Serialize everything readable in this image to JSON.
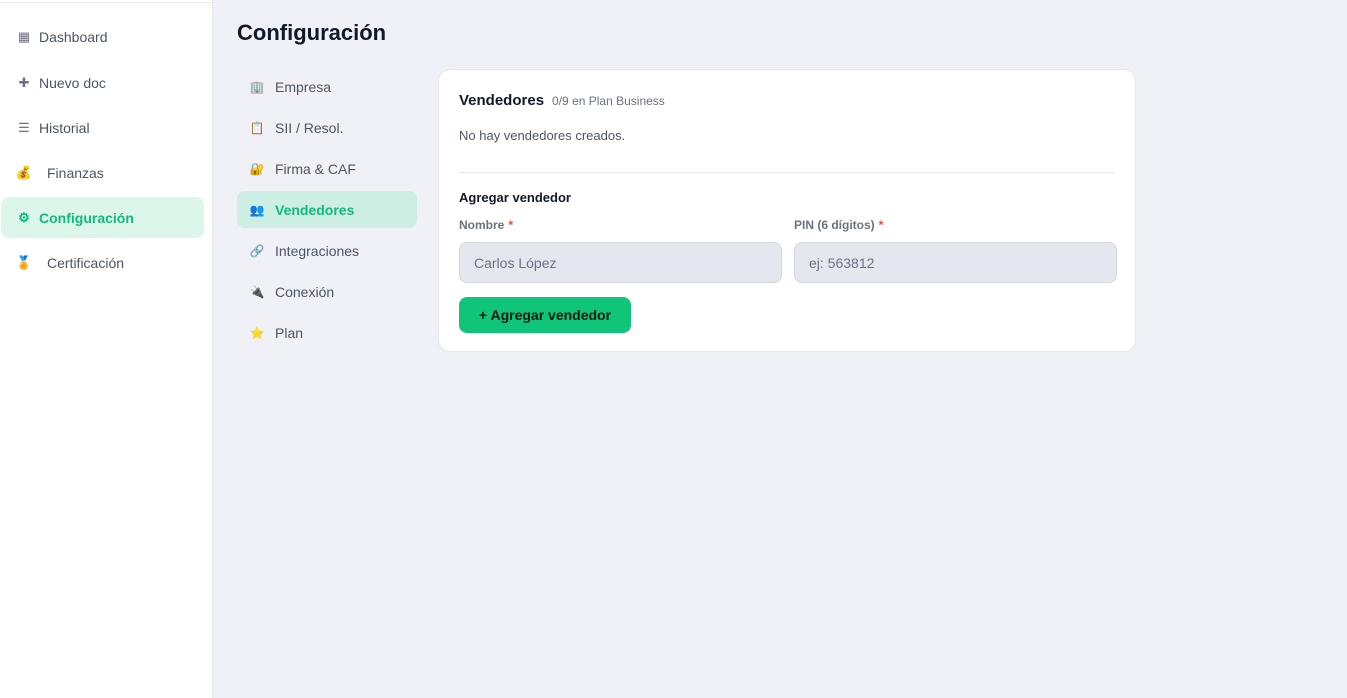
{
  "sidebar": {
    "items": [
      {
        "label": "Dashboard",
        "icon": "grid-icon",
        "glyph": "▦"
      },
      {
        "label": "Nuevo doc",
        "icon": "plus-icon",
        "glyph": "✚"
      },
      {
        "label": "Historial",
        "icon": "list-icon",
        "glyph": "☰"
      },
      {
        "label": "Finanzas",
        "icon": "money-bag-icon",
        "glyph": "💰"
      },
      {
        "label": "Configuración",
        "icon": "gear-icon",
        "glyph": "⚙"
      },
      {
        "label": "Certificación",
        "icon": "medal-icon",
        "glyph": "🏅"
      }
    ]
  },
  "main": {
    "title": "Configuración",
    "submenu": [
      {
        "label": "Empresa",
        "icon": "building-icon",
        "glyph": "🏢"
      },
      {
        "label": "SII / Resol.",
        "icon": "clipboard-icon",
        "glyph": "📋"
      },
      {
        "label": "Firma & CAF",
        "icon": "lock-key-icon",
        "glyph": "🔐"
      },
      {
        "label": "Vendedores",
        "icon": "people-icon",
        "glyph": "👥"
      },
      {
        "label": "Integraciones",
        "icon": "link-icon",
        "glyph": "🔗"
      },
      {
        "label": "Conexión",
        "icon": "plug-icon",
        "glyph": "🔌"
      },
      {
        "label": "Plan",
        "icon": "star-icon",
        "glyph": "⭐"
      }
    ],
    "card": {
      "title": "Vendedores",
      "meta": "0/9 en Plan Business",
      "empty_message": "No hay vendedores creados.",
      "section_title": "Agregar vendedor",
      "name_label": "Nombre",
      "name_required": "*",
      "name_placeholder": "Carlos López",
      "pin_label": "PIN (6 dígitos)",
      "pin_required": "*",
      "pin_placeholder": "ej: 563812",
      "add_button": "+ Agregar vendedor"
    }
  },
  "colors": {
    "accent": "#10b981",
    "button": "#10c47a",
    "active_bg": "#dcf7ea",
    "page_bg": "#f0f1f6"
  }
}
